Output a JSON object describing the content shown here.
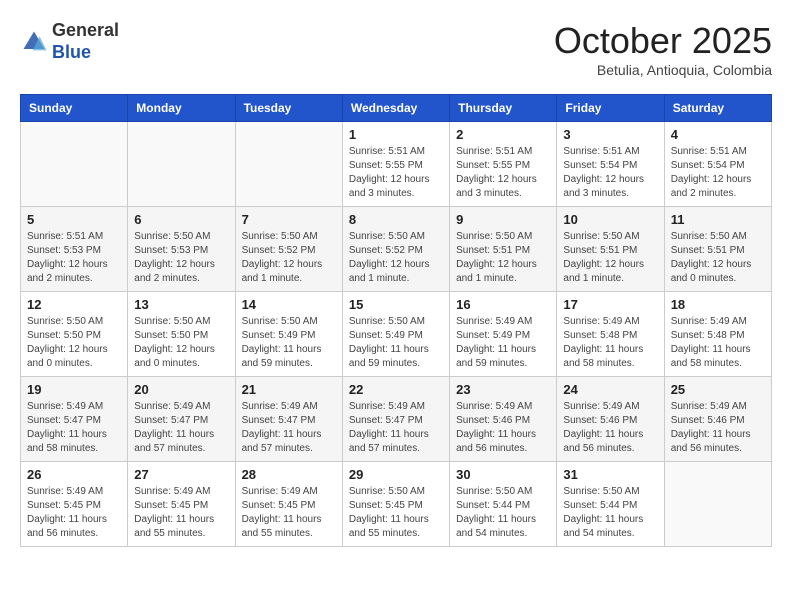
{
  "header": {
    "logo_line1": "General",
    "logo_line2": "Blue",
    "month": "October 2025",
    "location": "Betulia, Antioquia, Colombia"
  },
  "weekdays": [
    "Sunday",
    "Monday",
    "Tuesday",
    "Wednesday",
    "Thursday",
    "Friday",
    "Saturday"
  ],
  "weeks": [
    [
      {
        "day": "",
        "info": ""
      },
      {
        "day": "",
        "info": ""
      },
      {
        "day": "",
        "info": ""
      },
      {
        "day": "1",
        "info": "Sunrise: 5:51 AM\nSunset: 5:55 PM\nDaylight: 12 hours\nand 3 minutes."
      },
      {
        "day": "2",
        "info": "Sunrise: 5:51 AM\nSunset: 5:55 PM\nDaylight: 12 hours\nand 3 minutes."
      },
      {
        "day": "3",
        "info": "Sunrise: 5:51 AM\nSunset: 5:54 PM\nDaylight: 12 hours\nand 3 minutes."
      },
      {
        "day": "4",
        "info": "Sunrise: 5:51 AM\nSunset: 5:54 PM\nDaylight: 12 hours\nand 2 minutes."
      }
    ],
    [
      {
        "day": "5",
        "info": "Sunrise: 5:51 AM\nSunset: 5:53 PM\nDaylight: 12 hours\nand 2 minutes."
      },
      {
        "day": "6",
        "info": "Sunrise: 5:50 AM\nSunset: 5:53 PM\nDaylight: 12 hours\nand 2 minutes."
      },
      {
        "day": "7",
        "info": "Sunrise: 5:50 AM\nSunset: 5:52 PM\nDaylight: 12 hours\nand 1 minute."
      },
      {
        "day": "8",
        "info": "Sunrise: 5:50 AM\nSunset: 5:52 PM\nDaylight: 12 hours\nand 1 minute."
      },
      {
        "day": "9",
        "info": "Sunrise: 5:50 AM\nSunset: 5:51 PM\nDaylight: 12 hours\nand 1 minute."
      },
      {
        "day": "10",
        "info": "Sunrise: 5:50 AM\nSunset: 5:51 PM\nDaylight: 12 hours\nand 1 minute."
      },
      {
        "day": "11",
        "info": "Sunrise: 5:50 AM\nSunset: 5:51 PM\nDaylight: 12 hours\nand 0 minutes."
      }
    ],
    [
      {
        "day": "12",
        "info": "Sunrise: 5:50 AM\nSunset: 5:50 PM\nDaylight: 12 hours\nand 0 minutes."
      },
      {
        "day": "13",
        "info": "Sunrise: 5:50 AM\nSunset: 5:50 PM\nDaylight: 12 hours\nand 0 minutes."
      },
      {
        "day": "14",
        "info": "Sunrise: 5:50 AM\nSunset: 5:49 PM\nDaylight: 11 hours\nand 59 minutes."
      },
      {
        "day": "15",
        "info": "Sunrise: 5:50 AM\nSunset: 5:49 PM\nDaylight: 11 hours\nand 59 minutes."
      },
      {
        "day": "16",
        "info": "Sunrise: 5:49 AM\nSunset: 5:49 PM\nDaylight: 11 hours\nand 59 minutes."
      },
      {
        "day": "17",
        "info": "Sunrise: 5:49 AM\nSunset: 5:48 PM\nDaylight: 11 hours\nand 58 minutes."
      },
      {
        "day": "18",
        "info": "Sunrise: 5:49 AM\nSunset: 5:48 PM\nDaylight: 11 hours\nand 58 minutes."
      }
    ],
    [
      {
        "day": "19",
        "info": "Sunrise: 5:49 AM\nSunset: 5:47 PM\nDaylight: 11 hours\nand 58 minutes."
      },
      {
        "day": "20",
        "info": "Sunrise: 5:49 AM\nSunset: 5:47 PM\nDaylight: 11 hours\nand 57 minutes."
      },
      {
        "day": "21",
        "info": "Sunrise: 5:49 AM\nSunset: 5:47 PM\nDaylight: 11 hours\nand 57 minutes."
      },
      {
        "day": "22",
        "info": "Sunrise: 5:49 AM\nSunset: 5:47 PM\nDaylight: 11 hours\nand 57 minutes."
      },
      {
        "day": "23",
        "info": "Sunrise: 5:49 AM\nSunset: 5:46 PM\nDaylight: 11 hours\nand 56 minutes."
      },
      {
        "day": "24",
        "info": "Sunrise: 5:49 AM\nSunset: 5:46 PM\nDaylight: 11 hours\nand 56 minutes."
      },
      {
        "day": "25",
        "info": "Sunrise: 5:49 AM\nSunset: 5:46 PM\nDaylight: 11 hours\nand 56 minutes."
      }
    ],
    [
      {
        "day": "26",
        "info": "Sunrise: 5:49 AM\nSunset: 5:45 PM\nDaylight: 11 hours\nand 56 minutes."
      },
      {
        "day": "27",
        "info": "Sunrise: 5:49 AM\nSunset: 5:45 PM\nDaylight: 11 hours\nand 55 minutes."
      },
      {
        "day": "28",
        "info": "Sunrise: 5:49 AM\nSunset: 5:45 PM\nDaylight: 11 hours\nand 55 minutes."
      },
      {
        "day": "29",
        "info": "Sunrise: 5:50 AM\nSunset: 5:45 PM\nDaylight: 11 hours\nand 55 minutes."
      },
      {
        "day": "30",
        "info": "Sunrise: 5:50 AM\nSunset: 5:44 PM\nDaylight: 11 hours\nand 54 minutes."
      },
      {
        "day": "31",
        "info": "Sunrise: 5:50 AM\nSunset: 5:44 PM\nDaylight: 11 hours\nand 54 minutes."
      },
      {
        "day": "",
        "info": ""
      }
    ]
  ]
}
